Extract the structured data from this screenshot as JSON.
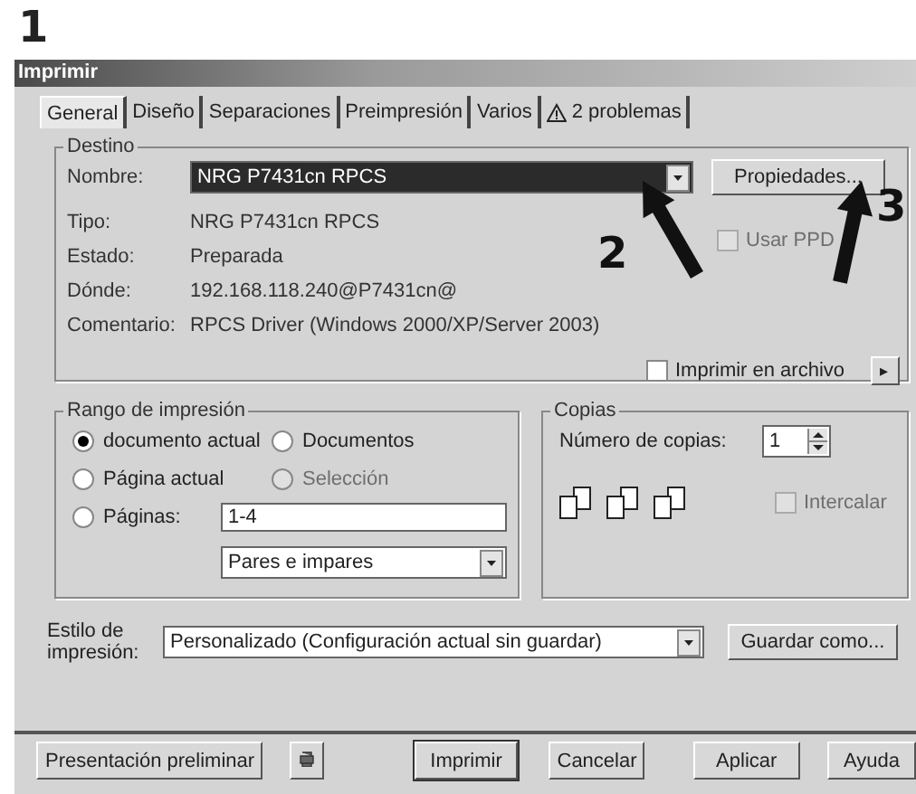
{
  "annotations": [
    {
      "label": "1",
      "kind": "plain"
    },
    {
      "label": "2",
      "kind": "arrow"
    },
    {
      "label": "3",
      "kind": "arrow"
    }
  ],
  "window": {
    "title": "Imprimir"
  },
  "tabs": [
    {
      "label": "General",
      "selected": true
    },
    {
      "label": "Diseño",
      "selected": false
    },
    {
      "label": "Separaciones",
      "selected": false
    },
    {
      "label": "Preimpresión",
      "selected": false
    },
    {
      "label": "Varios",
      "selected": false
    },
    {
      "label": "2 problemas",
      "selected": false,
      "kind": "warning"
    }
  ],
  "destino": {
    "title": "Destino",
    "name": {
      "label": "Nombre:",
      "value": "NRG P7431cn RPCS"
    },
    "properties_button": "Propiedades...",
    "use_ppd": {
      "label": "Usar PPD",
      "checked": false,
      "disabled": true
    },
    "info": [
      {
        "label": "Tipo:",
        "value": "NRG P7431cn RPCS"
      },
      {
        "label": "Estado:",
        "value": "Preparada"
      },
      {
        "label": "Dónde:",
        "value": "192.168.118.240@P7431cn@"
      },
      {
        "label": "Comentario:",
        "value": "RPCS Driver (Windows 2000/XP/Server 2003)"
      }
    ],
    "print_to_file": {
      "label": "Imprimir en archivo",
      "checked": false
    },
    "more_button": "▸"
  },
  "range": {
    "title": "Rango de impresión",
    "options": [
      {
        "label": "documento actual",
        "selected": true,
        "disabled": false
      },
      {
        "label": "Documentos",
        "selected": false,
        "disabled": false
      },
      {
        "label": "Página actual",
        "selected": false,
        "disabled": false
      },
      {
        "label": "Selección",
        "selected": false,
        "disabled": true
      },
      {
        "label": "Páginas:",
        "selected": false,
        "disabled": false
      }
    ],
    "pages": "1-4",
    "subset": "Pares e impares"
  },
  "copies": {
    "title": "Copias",
    "label": "Número de copias:",
    "value": "1",
    "collate": {
      "label": "Intercalar",
      "checked": false,
      "disabled": true
    }
  },
  "style": {
    "label": "Estilo de impresión:",
    "value": "Personalizado (Configuración actual sin guardar)",
    "button": "Guardar como..."
  },
  "buttons": [
    {
      "label": "Presentación preliminar",
      "kind": "text",
      "default": false
    },
    {
      "kind": "icon",
      "default": false
    },
    {
      "label": "Imprimir",
      "kind": "text",
      "default": true
    },
    {
      "label": "Cancelar",
      "kind": "text",
      "default": false
    },
    {
      "label": "Aplicar",
      "kind": "text",
      "default": false
    },
    {
      "label": "Ayuda",
      "kind": "text",
      "default": false
    }
  ]
}
